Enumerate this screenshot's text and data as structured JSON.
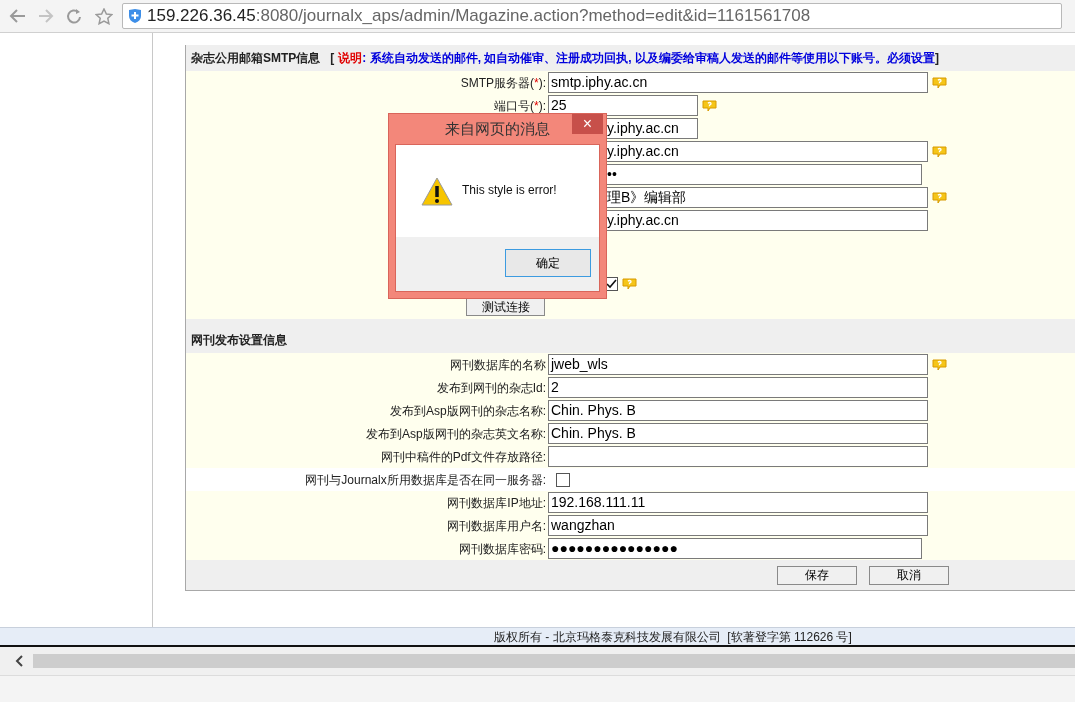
{
  "browser": {
    "url_host": "159.226.36.45",
    "url_rest": ":8080/journalx_aps/admin/Magazine.action?method=edit&id=1161561708"
  },
  "smtp_section": {
    "title": "杂志公用邮箱SMTP信息",
    "open_bracket": "[",
    "note_label": "说明",
    "note_text": ": 系统自动发送的邮件, 如自动催审、注册成功回执, 以及编委给审稿人发送的邮件等使用以下账号。必须设置",
    "close_bracket": "]",
    "rows": [
      {
        "kind": "text",
        "label_before": "SMTP服务器(",
        "mark": "*",
        "label_after": "):",
        "value": "smtp.iphy.ac.cn",
        "help": true
      },
      {
        "kind": "short_text",
        "label_before": "端口号(",
        "mark": "*",
        "label_after": "):",
        "value": "25",
        "help": true
      },
      {
        "kind": "short_text",
        "value": "y.iphy.ac.cn",
        "help": false
      },
      {
        "kind": "text",
        "value": "y.iphy.ac.cn",
        "help": true
      },
      {
        "kind": "password",
        "value": "••",
        "help": false
      },
      {
        "kind": "text",
        "value": "理B》编辑部",
        "help": true
      },
      {
        "kind": "text",
        "value": "y.iphy.ac.cn",
        "help": false
      },
      {
        "kind": "gap"
      },
      {
        "kind": "checkbox",
        "checked": true,
        "help": true
      },
      {
        "kind": "button",
        "label": "测试连接"
      }
    ]
  },
  "publish_section": {
    "title": "网刊发布设置信息",
    "rows": [
      {
        "kind": "text",
        "label": "网刊数据库的名称",
        "value": "jweb_wls",
        "help": true
      },
      {
        "kind": "text",
        "label": "发布到网刊的杂志Id:",
        "value": "2",
        "help": false
      },
      {
        "kind": "text",
        "label": "发布到Asp版网刊的杂志名称:",
        "value": "Chin. Phys. B",
        "help": false
      },
      {
        "kind": "text",
        "label": "发布到Asp版网刊的杂志英文名称:",
        "value": "Chin. Phys. B",
        "help": false
      },
      {
        "kind": "text",
        "label": "网刊中稿件的Pdf文件存放路径:",
        "help": false
      },
      {
        "kind": "checkbox",
        "label": "网刊与Journalx所用数据库是否在同一服务器:",
        "checked": false,
        "help": false
      },
      {
        "kind": "text",
        "label": "网刊数据库IP地址:",
        "value": "192.168.111.11",
        "help": false
      },
      {
        "kind": "text",
        "label": "网刊数据库用户名:",
        "value": "wangzhan",
        "help": false
      },
      {
        "kind": "password",
        "label": "网刊数据库密码:",
        "value": "●●●●●●●●●●●●●●●",
        "help": false
      }
    ],
    "buttons": [
      "保存",
      "取消"
    ]
  },
  "footer": "版权所有 - 北京玛格泰克科技发展有限公司  [软著登字第 112626 号]",
  "dialog": {
    "title": "来自网页的消息",
    "close": "×",
    "message": "This style is error!",
    "button": "确定"
  }
}
